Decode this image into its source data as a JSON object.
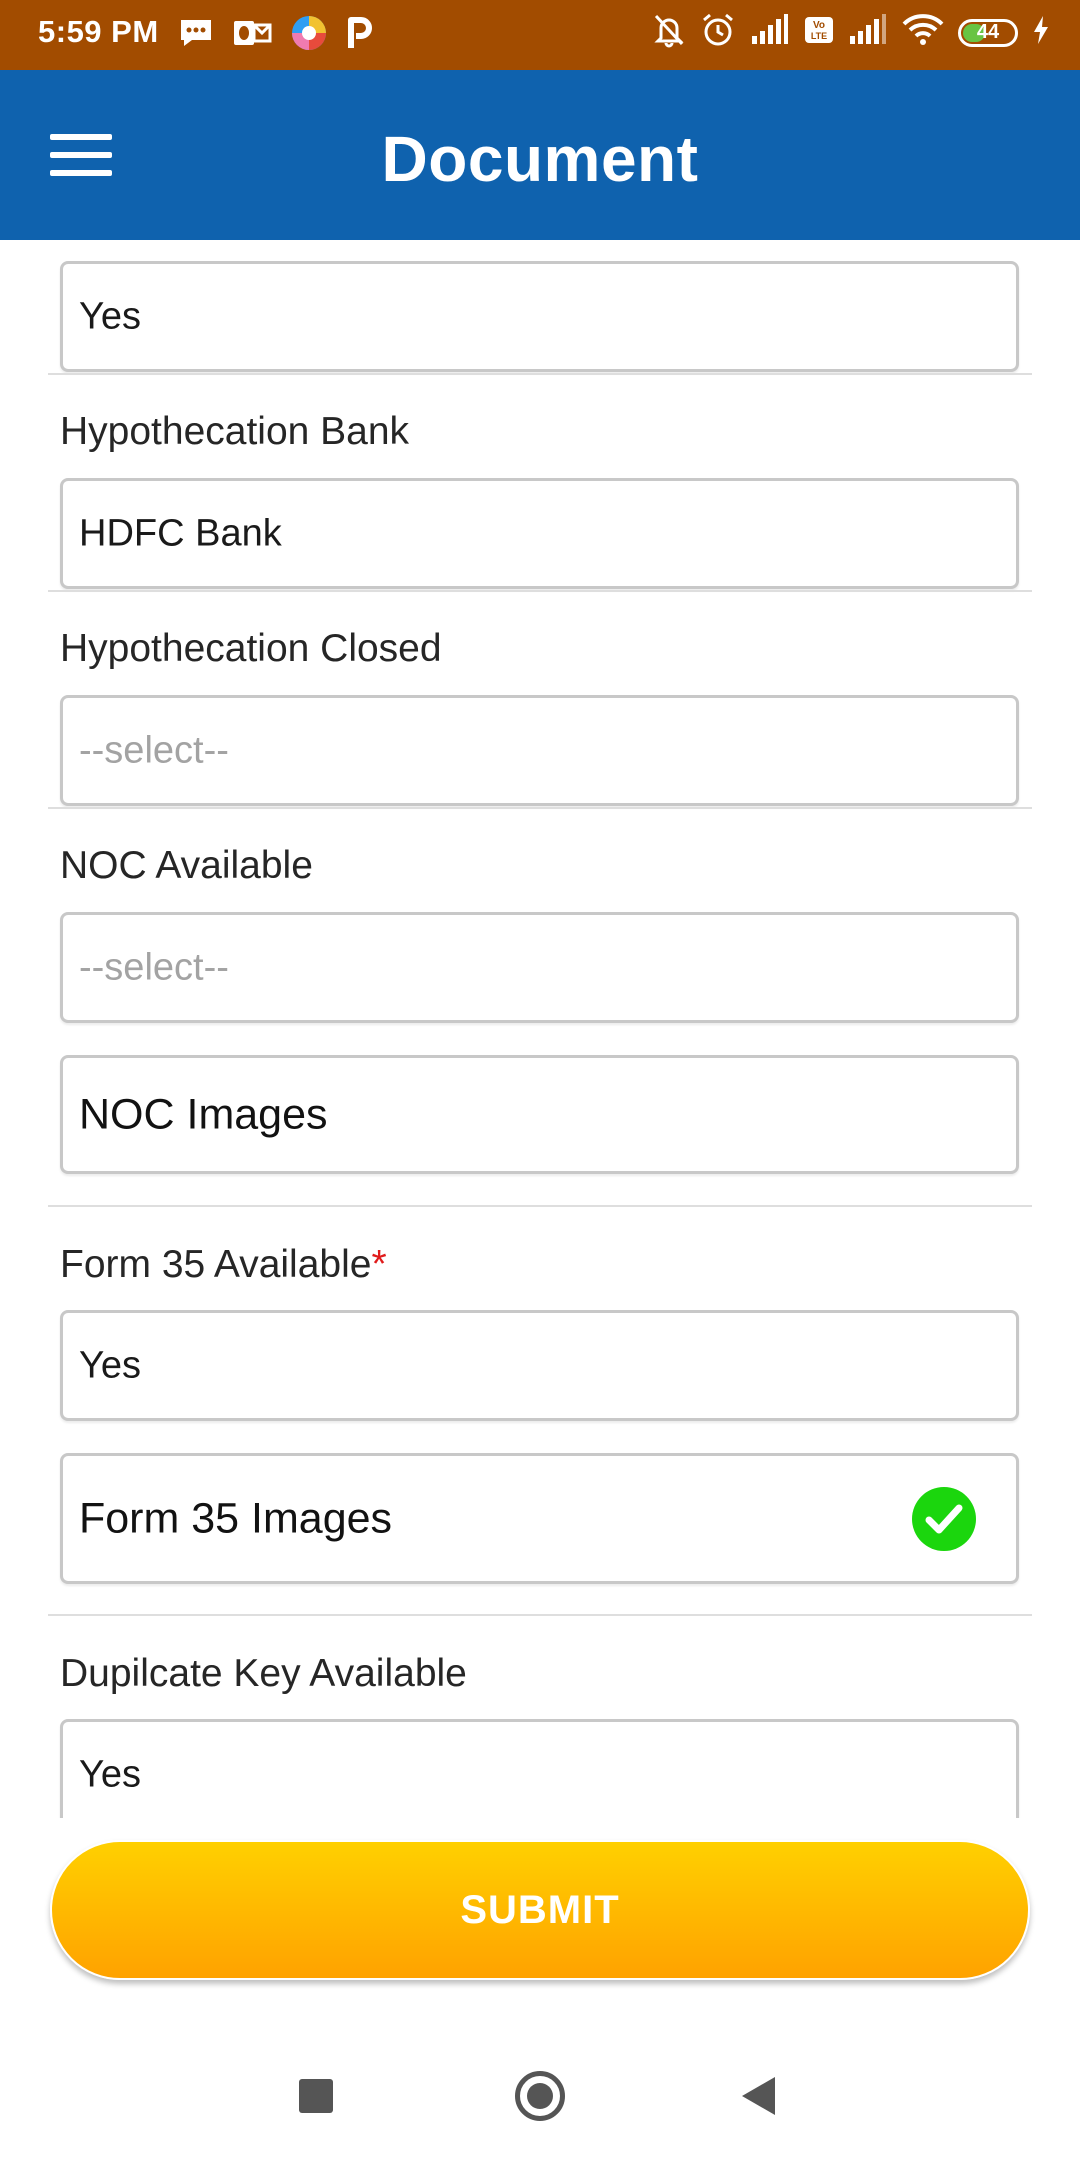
{
  "status_bar": {
    "time": "5:59 PM",
    "battery": "44",
    "left_icons": [
      "message-icon",
      "outlook-icon",
      "browser-icon",
      "paytm-icon"
    ],
    "right_icons": [
      "muted-bell-icon",
      "alarm-icon",
      "signal-icon",
      "volte-icon",
      "signal-icon",
      "wifi-icon",
      "battery-icon",
      "charging-icon"
    ]
  },
  "app_bar": {
    "title": "Document",
    "menu_icon": "hamburger-menu-icon",
    "background": "#0f62ae"
  },
  "form": {
    "hypothecation": {
      "value": "Yes"
    },
    "hypothecation_bank": {
      "label": "Hypothecation Bank",
      "value": "HDFC Bank"
    },
    "hypothecation_closed": {
      "label": "Hypothecation Closed",
      "placeholder": "--select--"
    },
    "noc_available": {
      "label": "NOC Available",
      "placeholder": "--select--"
    },
    "noc_images": {
      "label": "NOC Images"
    },
    "form35_available": {
      "label": "Form 35 Available",
      "required_mark": "*",
      "value": "Yes"
    },
    "form35_images": {
      "label": "Form 35 Images",
      "status_icon": "check-circle-icon",
      "status_color": "#1bd60d"
    },
    "duplicate_key_available": {
      "label": "Dupilcate Key Available",
      "value": "Yes"
    }
  },
  "submit": {
    "label": "SUBMIT",
    "color_top": "#ffd000",
    "color_bottom": "#ffa200"
  },
  "nav_bar": {
    "icons": [
      "recents-square-icon",
      "home-circle-icon",
      "back-triangle-icon"
    ]
  }
}
